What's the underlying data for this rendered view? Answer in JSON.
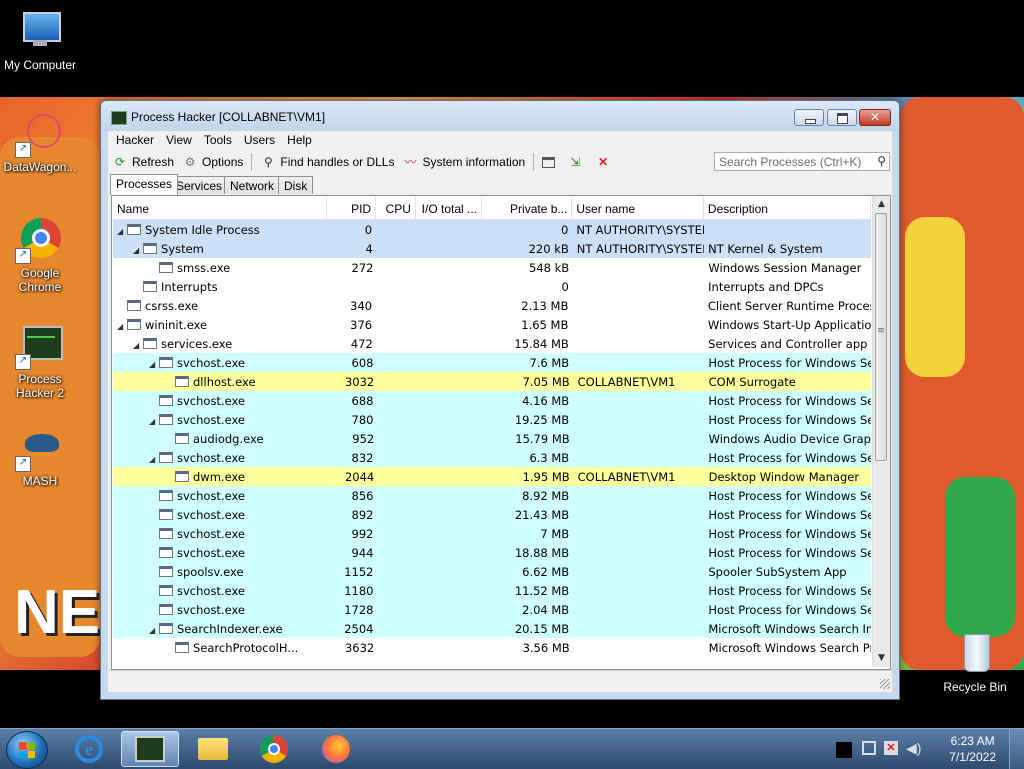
{
  "desktop": {
    "icons": [
      {
        "label": "My Computer"
      },
      {
        "label": "DataWagon..."
      },
      {
        "label": "Google Chrome"
      },
      {
        "label": "Process Hacker 2"
      },
      {
        "label": "MASH"
      },
      {
        "label": "Recycle Bin"
      }
    ]
  },
  "window": {
    "title": "Process Hacker [COLLABNET\\VM1]",
    "close_glyph": "✕"
  },
  "menu": [
    "Hacker",
    "View",
    "Tools",
    "Users",
    "Help"
  ],
  "toolbar": {
    "refresh": "Refresh",
    "options": "Options",
    "find_handles": "Find handles or DLLs",
    "system_information": "System information",
    "search_placeholder": "Search Processes (Ctrl+K)"
  },
  "tabs": [
    "Processes",
    "Services",
    "Network",
    "Disk"
  ],
  "columns": {
    "name": "Name",
    "pid": "PID",
    "cpu": "CPU",
    "io": "I/O total ...",
    "private": "Private b...",
    "user": "User name",
    "desc": "Description"
  },
  "processes": [
    {
      "name": "System Idle Process",
      "pid": "0",
      "private": "0",
      "user": "NT AUTHORITY\\SYSTEM",
      "desc": ""
    },
    {
      "name": "System",
      "pid": "4",
      "private": "220 kB",
      "user": "NT AUTHORITY\\SYSTEM",
      "desc": "NT Kernel & System"
    },
    {
      "name": "smss.exe",
      "pid": "272",
      "private": "548 kB",
      "user": "",
      "desc": "Windows Session Manager"
    },
    {
      "name": "Interrupts",
      "pid": "",
      "private": "0",
      "user": "",
      "desc": "Interrupts and DPCs"
    },
    {
      "name": "csrss.exe",
      "pid": "340",
      "private": "2.13 MB",
      "user": "",
      "desc": "Client Server Runtime Process"
    },
    {
      "name": "wininit.exe",
      "pid": "376",
      "private": "1.65 MB",
      "user": "",
      "desc": "Windows Start-Up Application"
    },
    {
      "name": "services.exe",
      "pid": "472",
      "private": "15.84 MB",
      "user": "",
      "desc": "Services and Controller app"
    },
    {
      "name": "svchost.exe",
      "pid": "608",
      "private": "7.6 MB",
      "user": "",
      "desc": "Host Process for Windows Ser..."
    },
    {
      "name": "dllhost.exe",
      "pid": "3032",
      "private": "7.05 MB",
      "user": "COLLABNET\\VM1",
      "desc": "COM Surrogate"
    },
    {
      "name": "svchost.exe",
      "pid": "688",
      "private": "4.16 MB",
      "user": "",
      "desc": "Host Process for Windows Ser..."
    },
    {
      "name": "svchost.exe",
      "pid": "780",
      "private": "19.25 MB",
      "user": "",
      "desc": "Host Process for Windows Ser..."
    },
    {
      "name": "audiodg.exe",
      "pid": "952",
      "private": "15.79 MB",
      "user": "",
      "desc": "Windows Audio Device Graph..."
    },
    {
      "name": "svchost.exe",
      "pid": "832",
      "private": "6.3 MB",
      "user": "",
      "desc": "Host Process for Windows Ser..."
    },
    {
      "name": "dwm.exe",
      "pid": "2044",
      "private": "1.95 MB",
      "user": "COLLABNET\\VM1",
      "desc": "Desktop Window Manager"
    },
    {
      "name": "svchost.exe",
      "pid": "856",
      "private": "8.92 MB",
      "user": "",
      "desc": "Host Process for Windows Ser..."
    },
    {
      "name": "svchost.exe",
      "pid": "892",
      "private": "21.43 MB",
      "user": "",
      "desc": "Host Process for Windows Ser..."
    },
    {
      "name": "svchost.exe",
      "pid": "992",
      "private": "7 MB",
      "user": "",
      "desc": "Host Process for Windows Ser..."
    },
    {
      "name": "svchost.exe",
      "pid": "944",
      "private": "18.88 MB",
      "user": "",
      "desc": "Host Process for Windows Ser..."
    },
    {
      "name": "spoolsv.exe",
      "pid": "1152",
      "private": "6.62 MB",
      "user": "",
      "desc": "Spooler SubSystem App"
    },
    {
      "name": "svchost.exe",
      "pid": "1180",
      "private": "11.52 MB",
      "user": "",
      "desc": "Host Process for Windows Ser..."
    },
    {
      "name": "svchost.exe",
      "pid": "1728",
      "private": "2.04 MB",
      "user": "",
      "desc": "Host Process for Windows Ser..."
    },
    {
      "name": "SearchIndexer.exe",
      "pid": "2504",
      "private": "20.15 MB",
      "user": "",
      "desc": "Microsoft Windows Search In..."
    },
    {
      "name": "SearchProtocolH...",
      "pid": "3632",
      "private": "3.56 MB",
      "user": "",
      "desc": "Microsoft Windows Search Pr..."
    }
  ],
  "taskbar": {
    "apps": [
      "internet-explorer",
      "process-hacker",
      "file-explorer",
      "chrome",
      "firefox"
    ],
    "time": "6:23 AM",
    "date": "7/1/2022"
  }
}
